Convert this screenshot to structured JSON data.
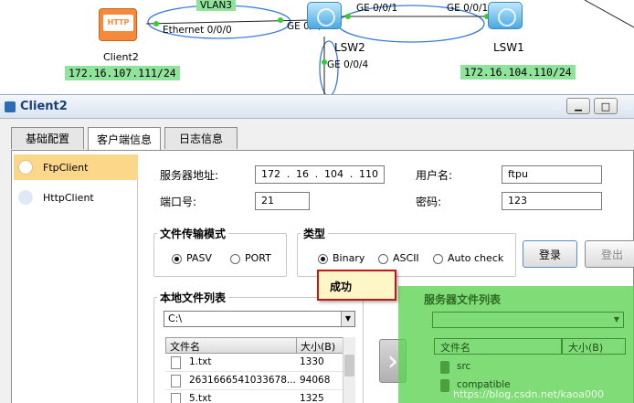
{
  "topology": {
    "vlan_label": "VLAN3",
    "client2_name": "Client2",
    "client2_ip": "172.16.107.111/24",
    "http_badge": "HTTP",
    "eth_label": "Ethernet 0/0/0",
    "ge003": "GE 0/0/3",
    "ge001_left": "GE 0/0/1",
    "ge001_right": "GE 0/0/1",
    "ge004": "GE 0/0/4",
    "lsw2": "LSW2",
    "lsw1": "LSW1",
    "lsw1_ip": "172.16.104.110/24"
  },
  "window": {
    "title": "Client2",
    "minimize_glyph": "▁",
    "maximize_glyph": "□"
  },
  "tabs": [
    "基础配置",
    "客户端信息",
    "日志信息"
  ],
  "sidebar": [
    "FtpClient",
    "HttpClient"
  ],
  "form": {
    "server_label": "服务器地址:",
    "server_ip": [
      "172",
      ".",
      "16",
      ".",
      "104",
      ".",
      "110"
    ],
    "port_label": "端口号:",
    "port_value": "21",
    "user_label": "用户名:",
    "user_value": "ftpu",
    "pass_label": "密码:",
    "pass_value": "123"
  },
  "transfer_mode": {
    "title": "文件传输模式",
    "options": [
      "PASV",
      "PORT"
    ],
    "selected": "PASV"
  },
  "type_group": {
    "title": "类型",
    "options": [
      "Binary",
      "ASCII",
      "Auto check"
    ],
    "selected": "Binary"
  },
  "buttons": {
    "login": "登录",
    "logout": "登出",
    "transfer_arrow": "›"
  },
  "status_popup": "成功",
  "local": {
    "title": "本地文件列表",
    "path": "C:\\",
    "col_name": "文件名",
    "col_size": "大小(B)",
    "rows": [
      {
        "name": "1.txt",
        "size": "1330"
      },
      {
        "name": "2631666541033678...",
        "size": "94068"
      },
      {
        "name": "5.txt",
        "size": "1325"
      }
    ]
  },
  "server": {
    "title": "服务器文件列表",
    "path": "",
    "col_name": "文件名",
    "col_size": "大小(B)",
    "rows": [
      {
        "name": "src",
        "size": ""
      },
      {
        "name": "compatible",
        "size": ""
      }
    ]
  },
  "watermark": "https://blog.csdn.net/kaoa000",
  "colors": {
    "highlight": "#8fe39b",
    "selected_sidebar": "#fbd78a",
    "overlay": "#5cd24f"
  }
}
